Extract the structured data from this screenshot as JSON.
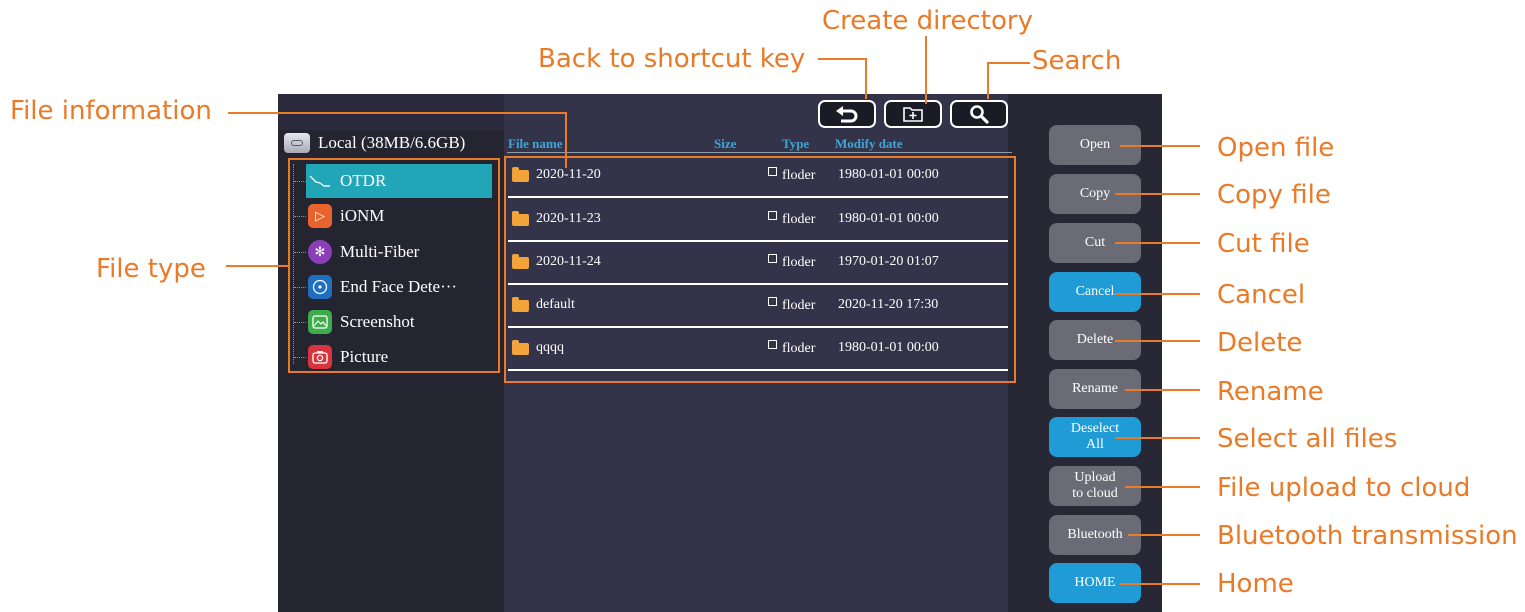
{
  "annotations": {
    "create_directory": "Create directory",
    "back_to_shortcut": "Back to shortcut key",
    "search": "Search",
    "file_information": "File information",
    "file_type": "File type",
    "open_file": "Open file",
    "copy_file": "Copy file",
    "cut_file": "Cut file",
    "cancel": "Cancel",
    "delete": "Delete",
    "rename": "Rename",
    "select_all": "Select all files",
    "upload": "File upload to cloud",
    "bluetooth": "Bluetooth transmission",
    "home": "Home"
  },
  "tree": {
    "root_label": "Local (38MB/6.6GB)",
    "items": [
      {
        "label": "OTDR",
        "icon": "otdr-icon",
        "selected": true
      },
      {
        "label": "iONM",
        "icon": "ionm-icon"
      },
      {
        "label": "Multi-Fiber",
        "icon": "multi-fiber-icon"
      },
      {
        "label": "End Face Dete···",
        "icon": "end-face-icon"
      },
      {
        "label": "Screenshot",
        "icon": "screenshot-icon"
      },
      {
        "label": "Picture",
        "icon": "picture-icon"
      }
    ]
  },
  "file_table": {
    "headers": {
      "name": "File name",
      "size": "Size",
      "type": "Type",
      "date": "Modify date"
    },
    "rows": [
      {
        "name": "2020-11-20",
        "type": "floder",
        "date": "1980-01-01 00:00"
      },
      {
        "name": "2020-11-23",
        "type": "floder",
        "date": "1980-01-01 00:00"
      },
      {
        "name": "2020-11-24",
        "type": "floder",
        "date": "1970-01-20 01:07"
      },
      {
        "name": "default",
        "type": "floder",
        "date": "2020-11-20 17:30"
      },
      {
        "name": "qqqq",
        "type": "floder",
        "date": "1980-01-01 00:00"
      }
    ]
  },
  "sidebar": {
    "open": "Open",
    "copy": "Copy",
    "cut": "Cut",
    "cancel": "Cancel",
    "delete": "Delete",
    "rename": "Rename",
    "deselect_all": "Deselect\nAll",
    "upload": "Upload\nto cloud",
    "bluetooth": "Bluetooth",
    "home": "HOME"
  },
  "colors": {
    "annotation": "#ea7a28",
    "accent_blue": "#1f9cd6",
    "selected_teal": "#21a6b8",
    "button_gray": "#6b6b75"
  }
}
